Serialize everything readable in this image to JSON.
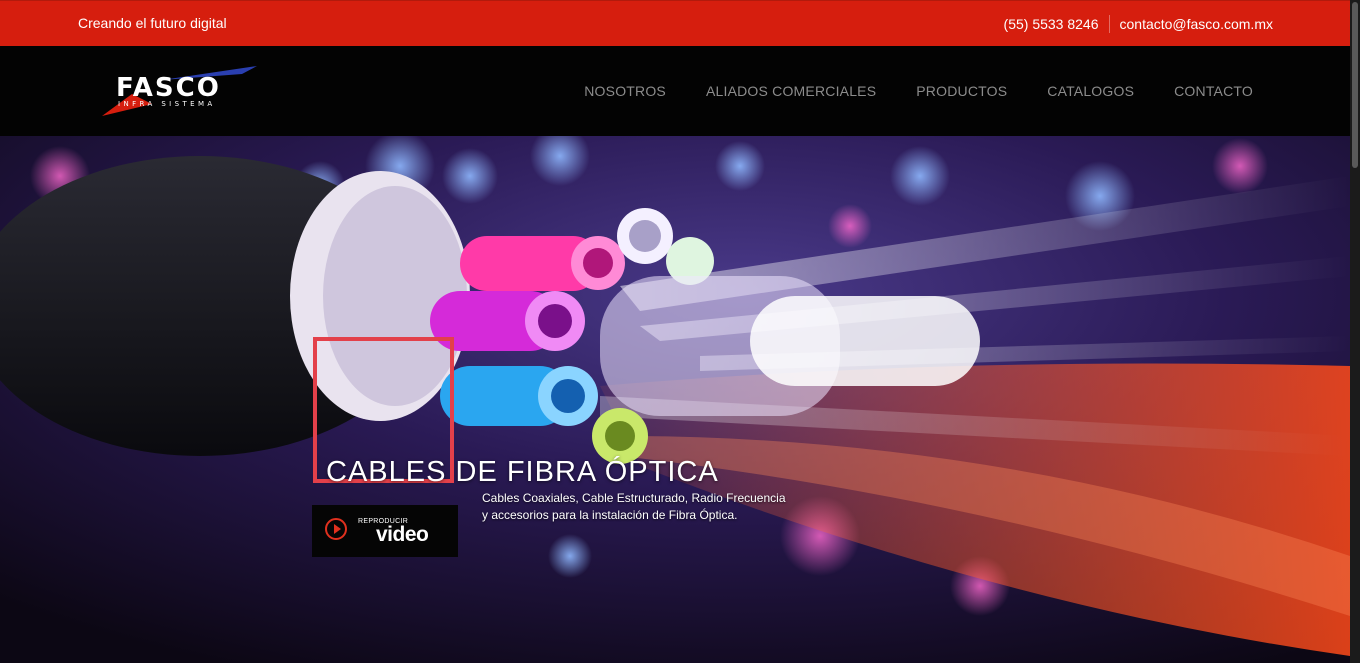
{
  "topbar": {
    "tagline": "Creando el futuro digital",
    "phone": "(55) 5533 8246",
    "email": "contacto@fasco.com.mx"
  },
  "logo": {
    "name": "FASCO",
    "subtitle": "INFRA SISTEMA"
  },
  "nav": {
    "items": [
      "NOSOTROS",
      "ALIADOS COMERCIALES",
      "PRODUCTOS",
      "CATALOGOS",
      "CONTACTO"
    ]
  },
  "hero": {
    "title": "CABLES DE FIBRA ÓPTICA",
    "description_line1": "Cables Coaxiales, Cable Estructurado, Radio Frecuencia",
    "description_line2": "y accesorios para la instalación de Fibra Óptica.",
    "video_small": "REPRODUCIR",
    "video_big": "video"
  },
  "colors": {
    "topbar": "#d61e0e",
    "header": "#030303",
    "nav_text": "#8c8c8c",
    "highlight_box": "#e3404a",
    "play_icon": "#e0301e"
  }
}
